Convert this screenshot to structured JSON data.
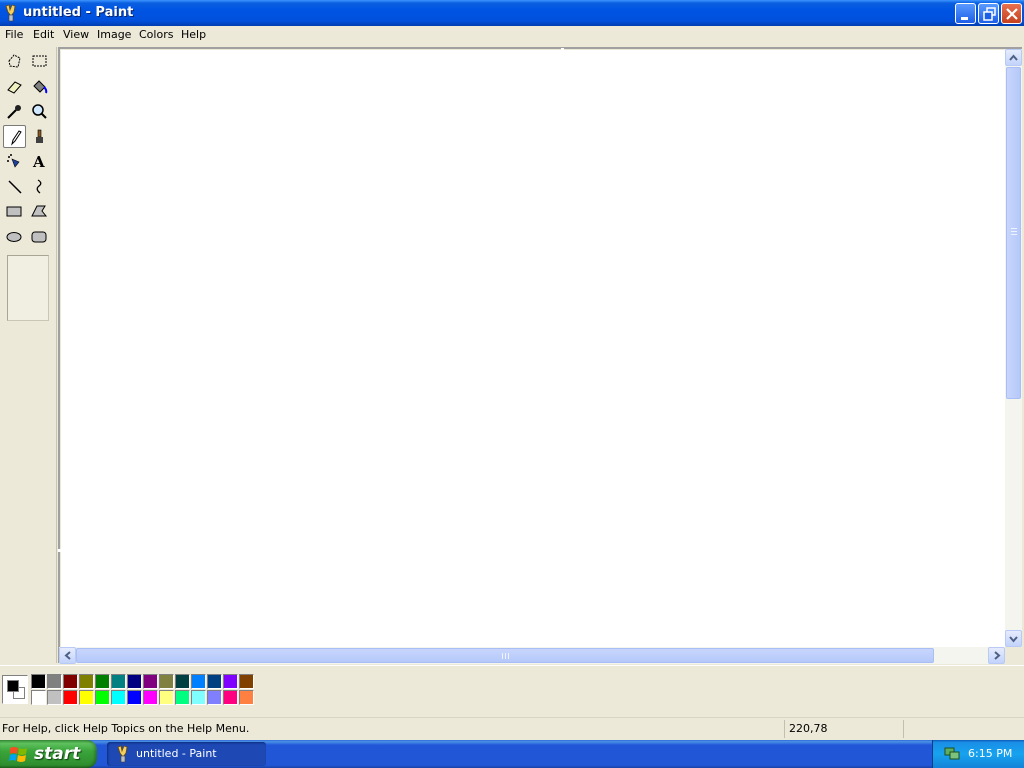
{
  "window": {
    "title": "untitled - Paint"
  },
  "menu": [
    "File",
    "Edit",
    "View",
    "Image",
    "Colors",
    "Help"
  ],
  "tools": [
    {
      "name": "free-form-select",
      "icon": "free-form-select-icon"
    },
    {
      "name": "select",
      "icon": "rect-select-icon"
    },
    {
      "name": "eraser",
      "icon": "eraser-icon"
    },
    {
      "name": "fill-with-color",
      "icon": "paint-bucket-icon"
    },
    {
      "name": "pick-color",
      "icon": "eyedropper-icon"
    },
    {
      "name": "magnifier",
      "icon": "magnifier-icon"
    },
    {
      "name": "pencil",
      "icon": "pencil-icon",
      "active": true
    },
    {
      "name": "brush",
      "icon": "brush-icon"
    },
    {
      "name": "airbrush",
      "icon": "airbrush-icon"
    },
    {
      "name": "text",
      "icon": "text-icon"
    },
    {
      "name": "line",
      "icon": "line-icon"
    },
    {
      "name": "curve",
      "icon": "curve-icon"
    },
    {
      "name": "rectangle",
      "icon": "rectangle-icon"
    },
    {
      "name": "polygon",
      "icon": "polygon-icon"
    },
    {
      "name": "ellipse",
      "icon": "ellipse-icon"
    },
    {
      "name": "rounded-rectangle",
      "icon": "rounded-rectangle-icon"
    }
  ],
  "current_colors": {
    "foreground": "#000000",
    "background": "#ffffff"
  },
  "palette_top": [
    "#000000",
    "#808080",
    "#800000",
    "#808000",
    "#008000",
    "#008080",
    "#000080",
    "#800080",
    "#808040",
    "#004040",
    "#0080ff",
    "#004080",
    "#8000ff",
    "#804000"
  ],
  "palette_bottom": [
    "#ffffff",
    "#c0c0c0",
    "#ff0000",
    "#ffff00",
    "#00ff00",
    "#00ffff",
    "#0000ff",
    "#ff00ff",
    "#ffff80",
    "#00ff80",
    "#80ffff",
    "#8080ff",
    "#ff0080",
    "#ff8040"
  ],
  "status": {
    "help_text": "For Help, click Help Topics on the Help Menu.",
    "coordinates": "220,78"
  },
  "taskbar": {
    "start_label": "start",
    "task_label": "untitled - Paint",
    "clock": "6:15 PM"
  }
}
